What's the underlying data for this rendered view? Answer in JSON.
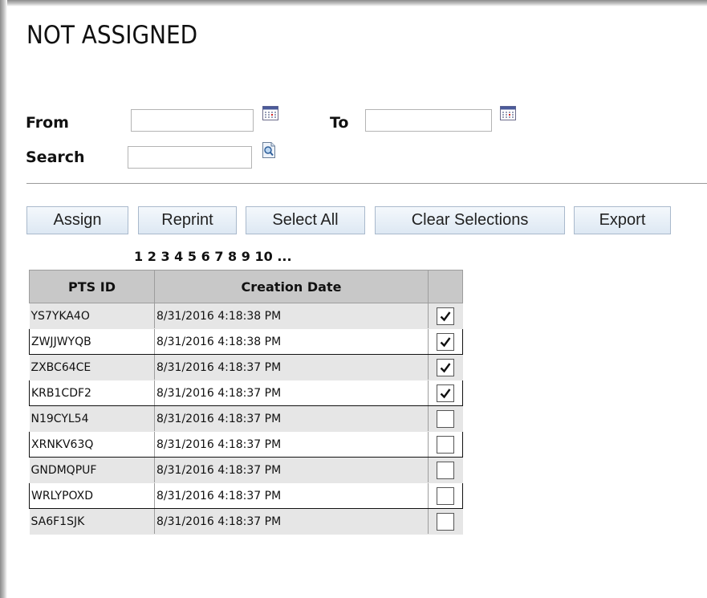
{
  "page": {
    "title": "NOT ASSIGNED"
  },
  "filters": {
    "from_label": "From",
    "from_value": "",
    "to_label": "To",
    "to_value": "",
    "search_label": "Search",
    "search_value": ""
  },
  "toolbar": {
    "assign_label": "Assign",
    "reprint_label": "Reprint",
    "select_all_label": "Select All",
    "clear_selections_label": "Clear Selections",
    "export_label": "Export"
  },
  "pager": {
    "pages": [
      "1",
      "2",
      "3",
      "4",
      "5",
      "6",
      "7",
      "8",
      "9",
      "10",
      "..."
    ]
  },
  "table": {
    "headers": [
      "PTS ID",
      "Creation Date",
      ""
    ],
    "rows": [
      {
        "pts_id": "YS7YKA4O",
        "creation_date": "8/31/2016 4:18:38 PM",
        "checked": true
      },
      {
        "pts_id": "ZWJJWYQB",
        "creation_date": "8/31/2016 4:18:38 PM",
        "checked": true
      },
      {
        "pts_id": "ZXBC64CE",
        "creation_date": "8/31/2016 4:18:37 PM",
        "checked": true
      },
      {
        "pts_id": "KRB1CDF2",
        "creation_date": "8/31/2016 4:18:37 PM",
        "checked": true
      },
      {
        "pts_id": "N19CYL54",
        "creation_date": "8/31/2016 4:18:37 PM",
        "checked": false
      },
      {
        "pts_id": "XRNKV63Q",
        "creation_date": "8/31/2016 4:18:37 PM",
        "checked": false
      },
      {
        "pts_id": "GNDMQPUF",
        "creation_date": "8/31/2016 4:18:37 PM",
        "checked": false
      },
      {
        "pts_id": "WRLYPOXD",
        "creation_date": "8/31/2016 4:18:37 PM",
        "checked": false
      },
      {
        "pts_id": "SA6F1SJK",
        "creation_date": "8/31/2016 4:18:37 PM",
        "checked": false
      }
    ]
  },
  "icons": {
    "calendar": "calendar-icon",
    "search": "search-icon",
    "check": "check-icon"
  },
  "colors": {
    "header_bg": "#c8c8c8",
    "odd_row_bg": "#e6e6e6",
    "button_top": "#f4f8fc",
    "button_bottom": "#dde8f3"
  }
}
